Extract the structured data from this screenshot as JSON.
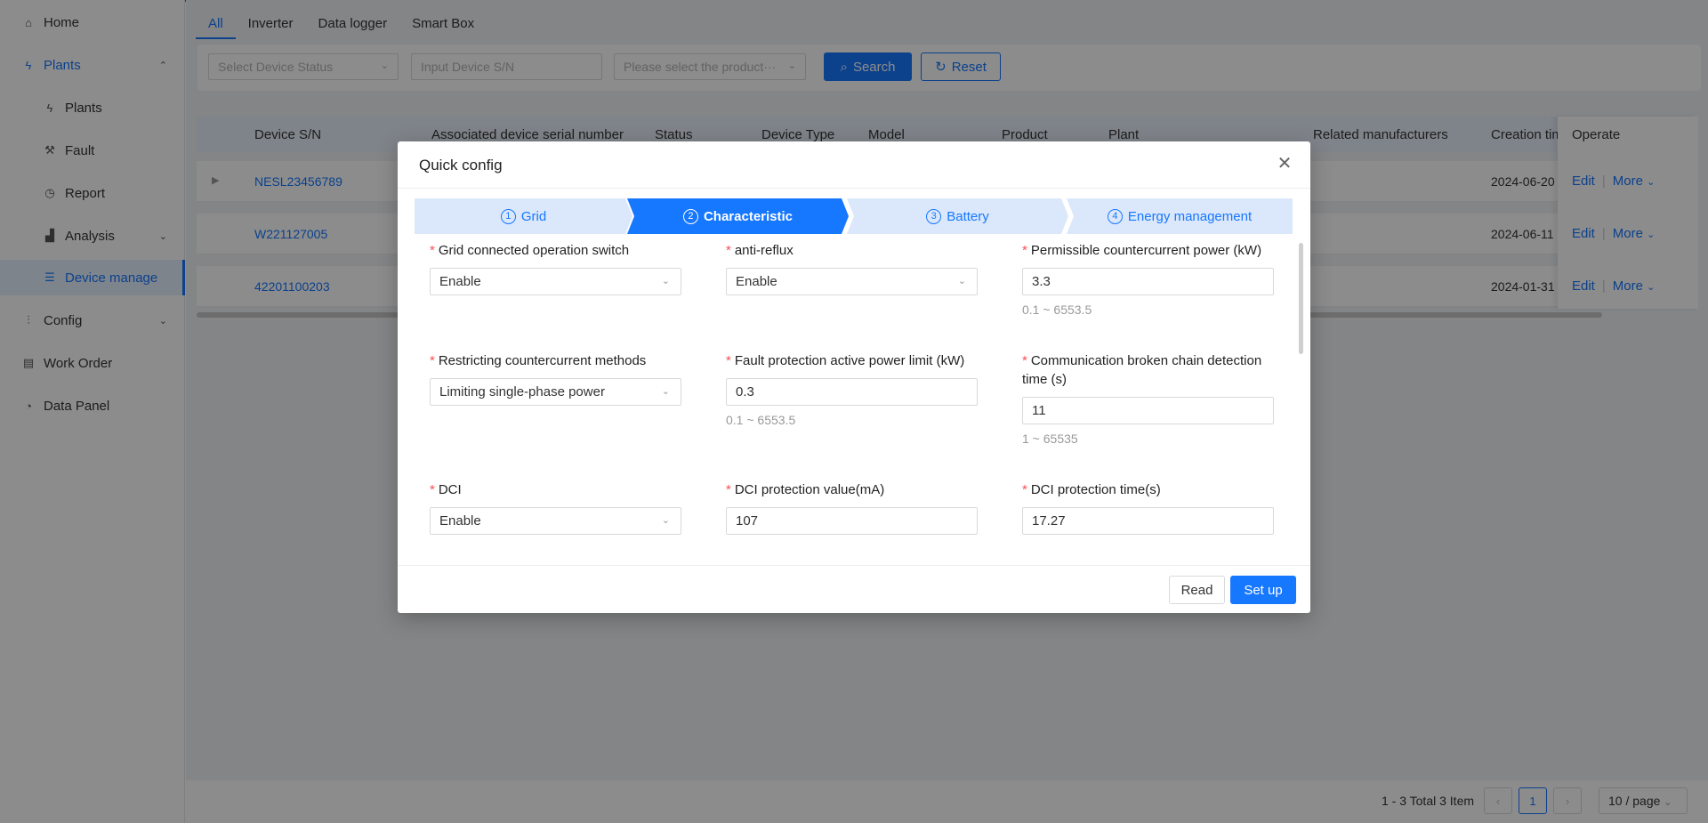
{
  "sidebar": {
    "items": [
      {
        "label": "Home",
        "icon": "home-icon"
      },
      {
        "label": "Plants",
        "icon": "lightning-icon"
      },
      {
        "label": "Plants",
        "icon": "lightning-icon"
      },
      {
        "label": "Fault",
        "icon": "wrench-icon"
      },
      {
        "label": "Report",
        "icon": "clock-icon"
      },
      {
        "label": "Analysis",
        "icon": "chart-icon"
      },
      {
        "label": "Device manage",
        "icon": "list-icon"
      },
      {
        "label": "Config",
        "icon": "sliders-icon"
      },
      {
        "label": "Work Order",
        "icon": "document-icon"
      },
      {
        "label": "Data Panel",
        "icon": "dashboard-icon"
      }
    ]
  },
  "tabs": [
    "All",
    "Inverter",
    "Data logger",
    "Smart Box"
  ],
  "filters": {
    "status_placeholder": "Select Device Status",
    "sn_placeholder": "Input Device S/N",
    "product_placeholder": "Please select the product···",
    "search_label": "Search",
    "reset_label": "Reset"
  },
  "table": {
    "columns": [
      "Device S/N",
      "Associated device serial number",
      "Status",
      "Device Type",
      "Model",
      "Product",
      "Plant",
      "Related manufacturers",
      "Creation tim",
      "Operate"
    ],
    "rows": [
      {
        "sn": "NESL23456789",
        "created": "2024-06-20"
      },
      {
        "sn": "W221127005",
        "created": "2024-06-11"
      },
      {
        "sn": "42201100203",
        "created": "2024-01-31"
      }
    ],
    "edit_label": "Edit",
    "more_label": "More"
  },
  "pagination": {
    "summary": "1 - 3 Total 3 Item",
    "current_page": "1",
    "page_size": "10 / page"
  },
  "modal": {
    "title": "Quick config",
    "steps": [
      {
        "num": "1",
        "label": "Grid"
      },
      {
        "num": "2",
        "label": "Characteristic"
      },
      {
        "num": "3",
        "label": "Battery"
      },
      {
        "num": "4",
        "label": "Energy management"
      }
    ],
    "active_step": 2,
    "fields": [
      {
        "label": "Grid connected operation switch",
        "value": "Enable",
        "type": "select",
        "hint": ""
      },
      {
        "label": "anti-reflux",
        "value": "Enable",
        "type": "select",
        "hint": ""
      },
      {
        "label": "Permissible countercurrent power (kW)",
        "value": "3.3",
        "type": "input",
        "hint": "0.1 ~ 6553.5"
      },
      {
        "label": "Restricting countercurrent methods",
        "value": "Limiting single-phase power",
        "type": "select",
        "hint": ""
      },
      {
        "label": "Fault protection active power limit (kW)",
        "value": "0.3",
        "type": "input",
        "hint": "0.1 ~ 6553.5"
      },
      {
        "label": "Communication broken chain detection time (s)",
        "value": "11",
        "type": "input",
        "hint": "1 ~ 65535"
      },
      {
        "label": "DCI",
        "value": "Enable",
        "type": "select",
        "hint": ""
      },
      {
        "label": "DCI protection value(mA)",
        "value": "107",
        "type": "input",
        "hint": ""
      },
      {
        "label": "DCI protection time(s)",
        "value": "17.27",
        "type": "input",
        "hint": ""
      }
    ],
    "read_label": "Read",
    "setup_label": "Set up"
  },
  "colors": {
    "accent": "#1677ff",
    "step_inactive": "#dbe8fb",
    "required": "#ff4d4f"
  }
}
